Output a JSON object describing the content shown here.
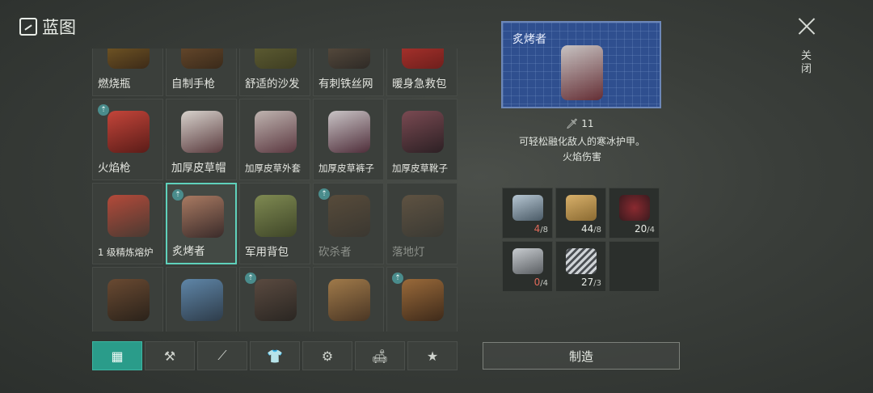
{
  "header": {
    "title": "蓝图"
  },
  "close": {
    "label": "关闭"
  },
  "grid": {
    "items": [
      {
        "label": "燃烧瓶",
        "icon": "molotov",
        "badge": false,
        "state": "normal"
      },
      {
        "label": "自制手枪",
        "icon": "pistol",
        "badge": false,
        "state": "normal"
      },
      {
        "label": "舒适的沙发",
        "icon": "sofa",
        "badge": false,
        "state": "normal"
      },
      {
        "label": "有刺铁丝网",
        "icon": "barbed-wire",
        "badge": false,
        "state": "normal"
      },
      {
        "label": "暖身急救包",
        "icon": "first-aid",
        "badge": false,
        "state": "normal"
      },
      {
        "label": "火焰枪",
        "icon": "flare-gun",
        "badge": true,
        "state": "normal"
      },
      {
        "label": "加厚皮草帽",
        "icon": "fur-hat",
        "badge": false,
        "state": "normal"
      },
      {
        "label": "加厚皮草外套",
        "icon": "fur-coat",
        "badge": false,
        "state": "normal"
      },
      {
        "label": "加厚皮草裤子",
        "icon": "fur-pants",
        "badge": false,
        "state": "normal"
      },
      {
        "label": "加厚皮草靴子",
        "icon": "fur-boots",
        "badge": false,
        "state": "normal"
      },
      {
        "label": "1 级精炼熔炉",
        "icon": "furnace",
        "badge": false,
        "state": "normal"
      },
      {
        "label": "炙烤者",
        "icon": "roaster-gun",
        "badge": true,
        "state": "selected"
      },
      {
        "label": "军用背包",
        "icon": "backpack",
        "badge": false,
        "state": "normal"
      },
      {
        "label": "砍杀者",
        "icon": "machete",
        "badge": true,
        "state": "dim"
      },
      {
        "label": "落地灯",
        "icon": "floor-lamp",
        "badge": false,
        "state": "dim"
      },
      {
        "label": "",
        "icon": "crossbow",
        "badge": false,
        "state": "normal"
      },
      {
        "label": "",
        "icon": "blueprint-board",
        "badge": false,
        "state": "normal"
      },
      {
        "label": "",
        "icon": "weapon",
        "badge": true,
        "state": "normal"
      },
      {
        "label": "",
        "icon": "sign",
        "badge": false,
        "state": "normal"
      },
      {
        "label": "",
        "icon": "rifle",
        "badge": true,
        "state": "normal"
      }
    ]
  },
  "tabs": [
    {
      "name": "all",
      "glyph": "▦"
    },
    {
      "name": "tools",
      "glyph": "⚒"
    },
    {
      "name": "weapons",
      "glyph": "⟋"
    },
    {
      "name": "clothing",
      "glyph": "👕"
    },
    {
      "name": "parts",
      "glyph": "⚙"
    },
    {
      "name": "furniture",
      "glyph": "🛋"
    },
    {
      "name": "favorites",
      "glyph": "★"
    }
  ],
  "detail": {
    "name": "炙烤者",
    "damage": "11",
    "description": "可轻松融化敌人的寒冰护甲。",
    "damage_type": "火焰伤害"
  },
  "materials": [
    {
      "name": "steel-ingot",
      "have": "4",
      "need": "/8",
      "low": true
    },
    {
      "name": "wood-plank",
      "have": "44",
      "need": "/8",
      "low": false
    },
    {
      "name": "red-powder",
      "have": "20",
      "need": "/4",
      "low": false
    },
    {
      "name": "pipe-parts",
      "have": "0",
      "need": "/4",
      "low": true
    },
    {
      "name": "spring",
      "have": "27",
      "need": "/3",
      "low": false
    }
  ],
  "craft": {
    "label": "制造"
  },
  "colors": {
    "accent": "#2a9c8a",
    "selected_border": "#5fd1bb",
    "low": "#e06a5a",
    "blueprint": "#2f4f8f"
  }
}
